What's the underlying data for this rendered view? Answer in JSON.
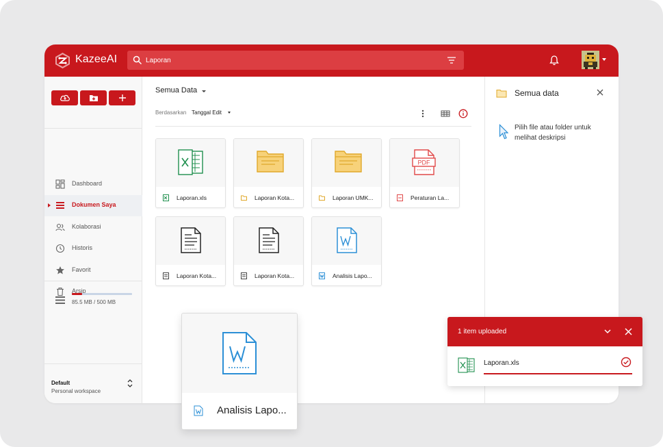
{
  "app": {
    "brand": "KazeeAI"
  },
  "header": {
    "search": {
      "value": "Laporan"
    },
    "icons": [
      "search-icon",
      "filter-icon",
      "bell-icon",
      "avatar",
      "chevron-down-icon"
    ]
  },
  "sidebar": {
    "actions": [
      "cloud-upload-icon",
      "folder-add-icon",
      "plus-icon"
    ],
    "items": [
      {
        "label": "Dashboard",
        "icon": "dashboard-icon",
        "active": false
      },
      {
        "label": "Dokumen Saya",
        "icon": "list-icon",
        "active": true
      },
      {
        "label": "Kolaborasi",
        "icon": "users-icon",
        "active": false
      },
      {
        "label": "Historis",
        "icon": "clock-icon",
        "active": false
      },
      {
        "label": "Favorit",
        "icon": "star-icon",
        "active": false
      },
      {
        "label": "Arsip",
        "icon": "trash-icon",
        "active": false
      }
    ],
    "storage": {
      "text": "85.5 MB / 500 MB",
      "used_fraction": 0.171
    },
    "workspace": {
      "name": "Default",
      "subtitle": "Personal workspace"
    }
  },
  "main": {
    "breadcrumb": "Semua Data",
    "sort_label": "Berdasarkan",
    "sort_value": "Tanggal Edit",
    "toolbar_icons": [
      "more-vertical-icon",
      "grid-view-icon",
      "info-icon"
    ],
    "files": [
      {
        "name": "Laporan.xls",
        "type": "xls"
      },
      {
        "name": "Laporan Kota...",
        "type": "folder"
      },
      {
        "name": "Laporan UMK...",
        "type": "folder"
      },
      {
        "name": "Peraturan La...",
        "type": "pdf"
      },
      {
        "name": "Laporan Kota...",
        "type": "doc"
      },
      {
        "name": "Laporan Kota...",
        "type": "doc"
      },
      {
        "name": "Analisis Lapo...",
        "type": "word"
      }
    ]
  },
  "detail_panel": {
    "title": "Semua data",
    "hint": "Pilih file atau folder untuk melihat deskripsi"
  },
  "drag_card": {
    "name": "Analisis Lapo...",
    "type": "word"
  },
  "upload_toast": {
    "title": "1 item uploaded",
    "file": "Laporan.xls",
    "progress": 1.0,
    "colors": {
      "accent": "#c8181d",
      "success": "#c8181d"
    }
  },
  "colors": {
    "brand": "#c8181d",
    "folder": "#f5c24a",
    "xls": "#1f8f4e",
    "word": "#2b8fd6",
    "pdf": "#e04848"
  }
}
